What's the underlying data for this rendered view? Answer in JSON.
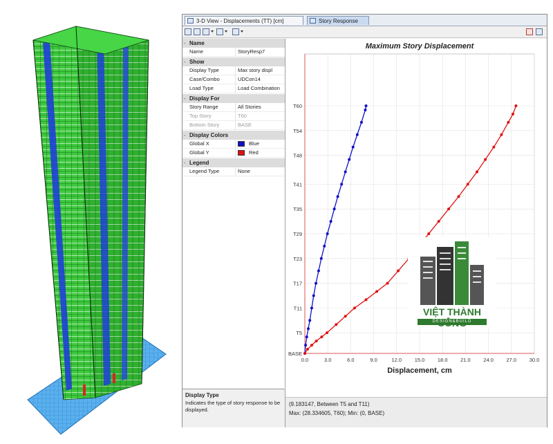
{
  "tabs": [
    {
      "label": "3-D View - Displacements (TT)  [cm]"
    },
    {
      "label": "Story Response"
    }
  ],
  "properties": {
    "name_section": {
      "title": "Name",
      "rows": [
        {
          "label": "Name",
          "value": "StoryResp7"
        }
      ]
    },
    "show_section": {
      "title": "Show",
      "rows": [
        {
          "label": "Display Type",
          "value": "Max story displ"
        },
        {
          "label": "Case/Combo",
          "value": "UDCon14"
        },
        {
          "label": "Load Type",
          "value": "Load Combination"
        }
      ]
    },
    "display_for_section": {
      "title": "Display For",
      "rows": [
        {
          "label": "Story Range",
          "value": "All Stories"
        },
        {
          "label": "Top Story",
          "value": "T60"
        },
        {
          "label": "Bottom Story",
          "value": "BASE"
        }
      ]
    },
    "display_colors_section": {
      "title": "Display Colors",
      "rows": [
        {
          "label": "Global X",
          "value": "Blue",
          "color": "#1010c8"
        },
        {
          "label": "Global Y",
          "value": "Red",
          "color": "#e01010"
        }
      ]
    },
    "legend_section": {
      "title": "Legend",
      "rows": [
        {
          "label": "Legend Type",
          "value": "None"
        }
      ]
    }
  },
  "help": {
    "title": "Display Type",
    "text": "Indicates the type of story response to be displayed."
  },
  "status": {
    "line1": "(9.183147, Between T5 and T11)",
    "line2": "Max: (28.334605, T60);  Min: (0, BASE)"
  },
  "logo": {
    "name": "VIỆT THÀNH CÔNG",
    "tagline": "DESIGN&BUILD"
  },
  "chart_data": {
    "type": "line",
    "title": "Maximum Story Displacement",
    "xlabel": "Displacement, cm",
    "ylabel": "",
    "xlim": [
      0,
      30
    ],
    "x_ticks": [
      0.0,
      3.0,
      6.0,
      9.0,
      12.0,
      15.0,
      18.0,
      21.0,
      24.0,
      27.0,
      30.0
    ],
    "x_tick_labels": [
      "0.0",
      "3.0",
      "6.0",
      "9.0",
      "12.0",
      "15.0",
      "18.0",
      "21.0",
      "24.0",
      "27.0",
      "30.0"
    ],
    "y_ticks": [
      0,
      5,
      11,
      17,
      23,
      29,
      35,
      41,
      48,
      54,
      60
    ],
    "y_tick_labels": [
      "BASE",
      "T5",
      "T11",
      "T17",
      "T23",
      "T29",
      "T35",
      "T41",
      "T48",
      "T54",
      "T60"
    ],
    "ylim": [
      0,
      60
    ],
    "grid": true,
    "series": [
      {
        "name": "Global X",
        "color": "#1010c8",
        "points": [
          [
            0.0,
            0
          ],
          [
            0.1,
            2
          ],
          [
            0.25,
            4
          ],
          [
            0.45,
            6
          ],
          [
            0.65,
            8
          ],
          [
            0.9,
            11
          ],
          [
            1.15,
            14
          ],
          [
            1.45,
            17
          ],
          [
            1.8,
            20
          ],
          [
            2.15,
            23
          ],
          [
            2.55,
            26
          ],
          [
            2.95,
            29
          ],
          [
            3.4,
            32
          ],
          [
            3.85,
            35
          ],
          [
            4.3,
            38
          ],
          [
            4.8,
            41
          ],
          [
            5.3,
            44
          ],
          [
            5.8,
            47
          ],
          [
            6.3,
            50
          ],
          [
            6.85,
            53
          ],
          [
            7.4,
            56
          ],
          [
            7.9,
            59
          ],
          [
            8.0,
            60
          ]
        ]
      },
      {
        "name": "Global Y",
        "color": "#e01010",
        "points": [
          [
            0.0,
            0
          ],
          [
            0.35,
            1
          ],
          [
            0.9,
            2
          ],
          [
            1.5,
            3
          ],
          [
            2.2,
            4
          ],
          [
            2.9,
            5
          ],
          [
            4.1,
            7
          ],
          [
            5.3,
            9
          ],
          [
            6.5,
            11
          ],
          [
            8.0,
            13
          ],
          [
            9.4,
            15
          ],
          [
            10.8,
            17
          ],
          [
            12.2,
            20
          ],
          [
            13.6,
            23
          ],
          [
            14.9,
            26
          ],
          [
            16.2,
            29
          ],
          [
            17.5,
            32
          ],
          [
            18.8,
            35
          ],
          [
            20.1,
            38
          ],
          [
            21.3,
            41
          ],
          [
            22.5,
            44
          ],
          [
            23.6,
            47
          ],
          [
            24.7,
            50
          ],
          [
            25.7,
            53
          ],
          [
            26.6,
            56
          ],
          [
            27.2,
            58
          ],
          [
            27.6,
            60
          ]
        ]
      }
    ]
  }
}
